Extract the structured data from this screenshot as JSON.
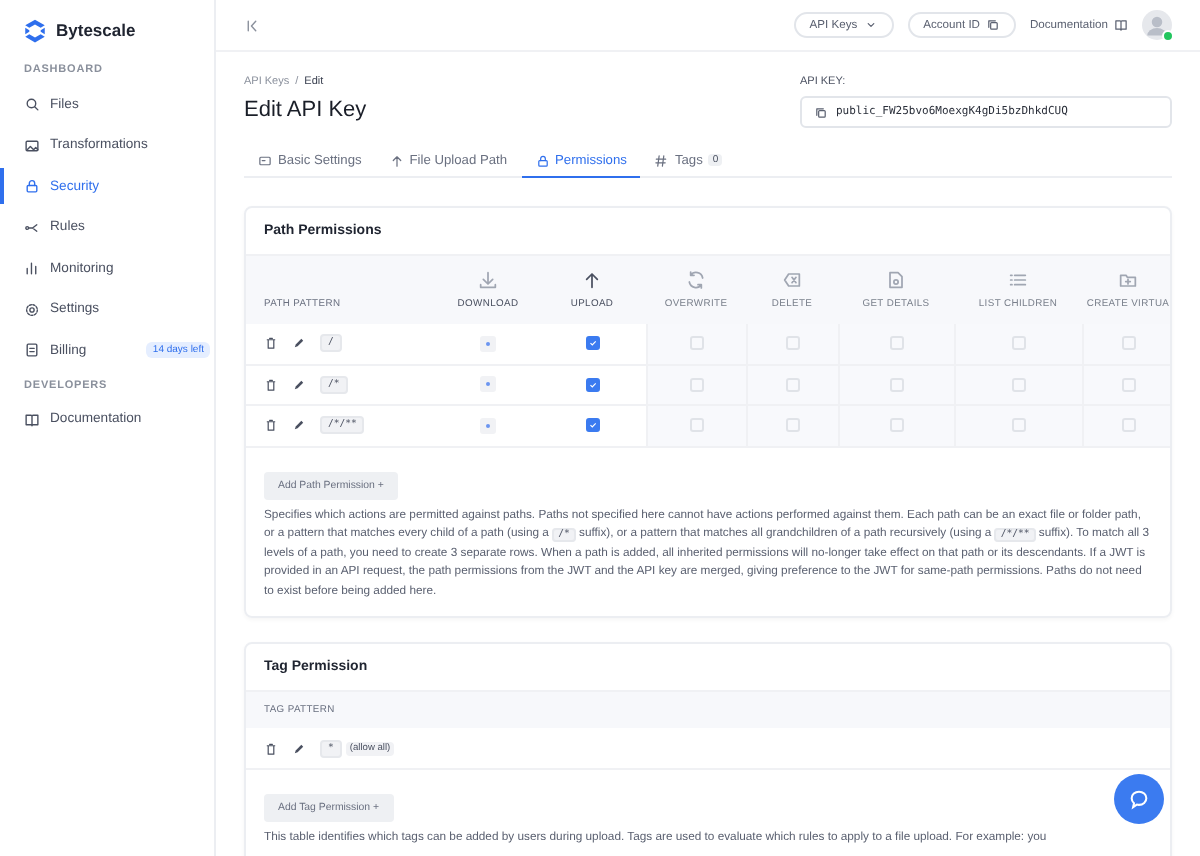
{
  "sidebar": {
    "logo": "Bytescale",
    "sections": [
      {
        "heading": "DASHBOARD",
        "items": [
          {
            "label": "Files",
            "kind": "files",
            "selected": false
          },
          {
            "label": "Transformations",
            "kind": "image",
            "selected": false
          },
          {
            "label": "Security",
            "kind": "lock",
            "selected": true
          },
          {
            "label": "Rules",
            "kind": "rules",
            "selected": false
          },
          {
            "label": "Monitoring",
            "kind": "chart",
            "selected": false
          },
          {
            "label": "Settings",
            "kind": "gear",
            "selected": false
          },
          {
            "label": "Billing",
            "kind": "doc",
            "selected": false,
            "badge": "14 days left"
          }
        ]
      },
      {
        "heading": "DEVELOPERS",
        "items": [
          {
            "label": "Documentation",
            "kind": "book",
            "selected": false
          }
        ]
      }
    ]
  },
  "topbar": {
    "buttons": [
      {
        "label": "API Keys",
        "kind": "dropdown"
      },
      {
        "label": "Account ID",
        "kind": "copy"
      },
      {
        "label": "Documentation",
        "kind": "link"
      }
    ]
  },
  "breadcrumb": {
    "items": [
      "API Keys",
      "Edit"
    ],
    "separator": "/"
  },
  "title": "Edit API Key",
  "api_key": {
    "label": "API KEY:",
    "value": "public_FW25bvo6MoexgK4gDi5bzDhkdCUQ"
  },
  "tabs": [
    {
      "label": "Basic Settings",
      "kind": "card",
      "selected": false
    },
    {
      "label": "File Upload Path",
      "kind": "upload",
      "selected": false
    },
    {
      "label": "Permissions",
      "kind": "lock",
      "selected": true
    },
    {
      "label": "Tags",
      "kind": "hash",
      "selected": false,
      "count": "0"
    }
  ],
  "path_permissions": {
    "title": "Path Permissions",
    "pattern_column": "PATH PATTERN",
    "columns": [
      {
        "label": "DOWNLOAD",
        "kind": "download",
        "disabled": false
      },
      {
        "label": "UPLOAD",
        "kind": "upload",
        "disabled": false
      },
      {
        "label": "OVERWRITE",
        "kind": "refresh",
        "disabled": true
      },
      {
        "label": "DELETE",
        "kind": "backspace",
        "disabled": true
      },
      {
        "label": "GET DETAILS",
        "kind": "details",
        "disabled": true
      },
      {
        "label": "LIST CHILDREN",
        "kind": "list",
        "disabled": true
      },
      {
        "label": "CREATE VIRTUA",
        "kind": "folder",
        "disabled": true
      }
    ],
    "rows": [
      {
        "pattern": "/",
        "cells": [
          {
            "kind": "inherited"
          },
          {
            "kind": "checkbox",
            "checked": true
          },
          {
            "kind": "checkbox",
            "checked": false
          },
          {
            "kind": "checkbox",
            "checked": false
          },
          {
            "kind": "checkbox",
            "checked": false
          },
          {
            "kind": "checkbox",
            "checked": false
          },
          {
            "kind": "checkbox",
            "checked": false
          }
        ]
      },
      {
        "pattern": "/*",
        "cells": [
          {
            "kind": "inherited"
          },
          {
            "kind": "checkbox",
            "checked": true
          },
          {
            "kind": "checkbox",
            "checked": false
          },
          {
            "kind": "checkbox",
            "checked": false
          },
          {
            "kind": "checkbox",
            "checked": false
          },
          {
            "kind": "checkbox",
            "checked": false
          },
          {
            "kind": "checkbox",
            "checked": false
          }
        ]
      },
      {
        "pattern": "/*/**",
        "cells": [
          {
            "kind": "inherited"
          },
          {
            "kind": "checkbox",
            "checked": true
          },
          {
            "kind": "checkbox",
            "checked": false
          },
          {
            "kind": "checkbox",
            "checked": false
          },
          {
            "kind": "checkbox",
            "checked": false
          },
          {
            "kind": "checkbox",
            "checked": false
          },
          {
            "kind": "checkbox",
            "checked": false
          }
        ]
      }
    ],
    "add_button": "Add Path Permission +",
    "description": [
      {
        "kind": "text",
        "text": "Specifies which actions are permitted against paths. Paths not specified here cannot have actions performed against them. Each path can be an exact file or folder path, or a pattern that matches every child of a path (using a "
      },
      {
        "kind": "code",
        "text": "/*"
      },
      {
        "kind": "text",
        "text": " suffix), or a pattern that matches all grandchildren of a path recursively (using a "
      },
      {
        "kind": "code",
        "text": "/*/**"
      },
      {
        "kind": "text",
        "text": " suffix). To match all 3 levels of a path, you need to create 3 separate rows. When a path is added, all inherited permissions will no-longer take effect on that path or its descendants. If a JWT is provided in an API request, the path permissions from the JWT and the API key are merged, giving preference to the JWT for same-path permissions. Paths do not need to exist before being added here."
      }
    ]
  },
  "tag_permission": {
    "title": "Tag Permission",
    "pattern_column": "TAG PATTERN",
    "rows": [
      {
        "pattern": "*",
        "note": "(allow all)"
      }
    ],
    "add_button": "Add Tag Permission +",
    "description": "This table identifies which tags can be added by users during upload. Tags are used to evaluate which rules to apply to a file upload. For example: you"
  }
}
